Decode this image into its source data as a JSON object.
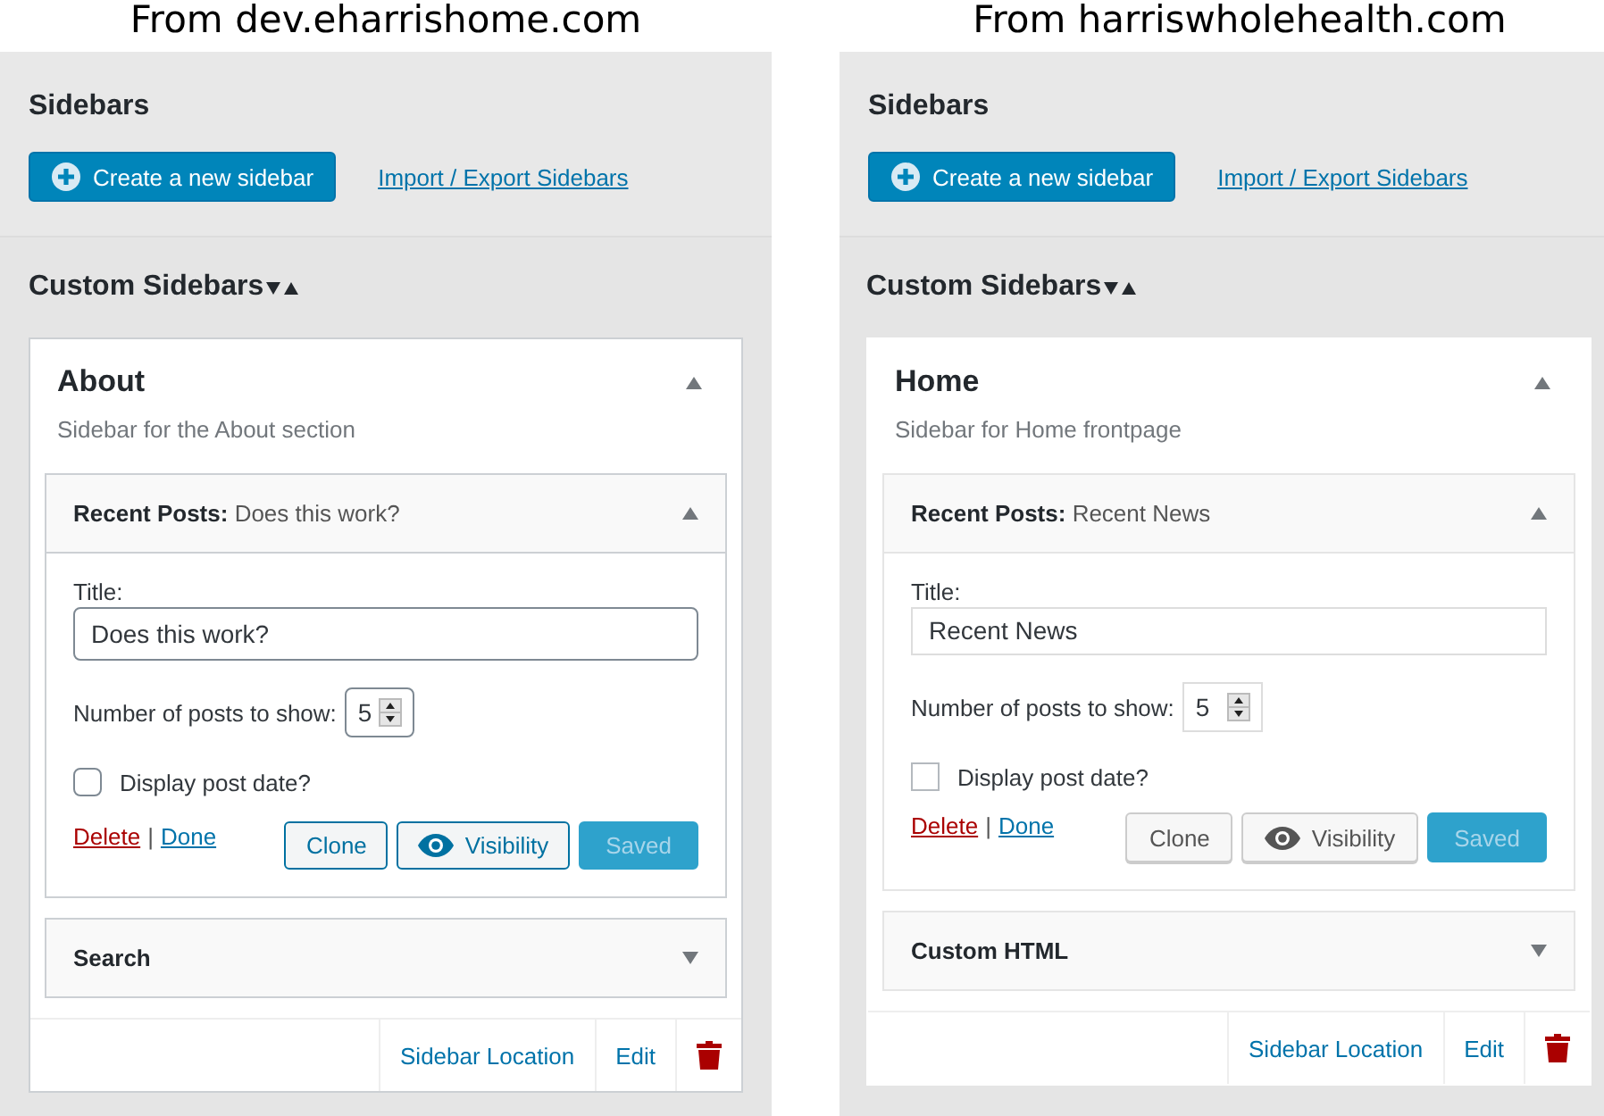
{
  "panels": [
    {
      "caption": "From dev.eharrishome.com",
      "kind": "modern",
      "heading": "Sidebars",
      "create_button": "Create a new sidebar",
      "import_link": "Import / Export Sidebars",
      "section_title": "Custom Sidebars",
      "sidebar": {
        "name": "About",
        "description": "Sidebar for the About section",
        "expanded": true,
        "widgets": [
          {
            "kind": "form",
            "header": "**Recent Posts:** Does this work?",
            "expanded": true,
            "title_label": "Title:",
            "title_value": "Does this work?",
            "count_label": "Number of posts to show:",
            "count_value": "5",
            "date_label": "Display post date?",
            "date_checked": false,
            "delete_link": "Delete",
            "separator": "|",
            "done_link": "Done",
            "clone_button": "Clone",
            "visibility_button": "Visibility",
            "saved_button": "Saved"
          },
          {
            "kind": "collapsed",
            "header": "**Search**",
            "expanded": false
          }
        ],
        "location_link": "Sidebar Location",
        "edit_link": "Edit"
      }
    },
    {
      "caption": "From harriswholehealth.com",
      "kind": "classic",
      "heading": "Sidebars",
      "create_button": "Create a new sidebar",
      "import_link": "Import / Export Sidebars",
      "section_title": "Custom Sidebars",
      "sidebar": {
        "name": "Home",
        "description": "Sidebar for Home frontpage",
        "expanded": true,
        "widgets": [
          {
            "kind": "form",
            "header": "**Recent Posts:** Recent News",
            "expanded": true,
            "title_label": "Title:",
            "title_value": "Recent News",
            "count_label": "Number of posts to show:",
            "count_value": "5",
            "date_label": "Display post date?",
            "date_checked": false,
            "delete_link": "Delete",
            "separator": "|",
            "done_link": "Done",
            "clone_button": "Clone",
            "visibility_button": "Visibility",
            "saved_button": "Saved"
          },
          {
            "kind": "collapsed",
            "header": "**Custom HTML**",
            "expanded": false
          }
        ],
        "location_link": "Sidebar Location",
        "edit_link": "Edit"
      }
    }
  ]
}
